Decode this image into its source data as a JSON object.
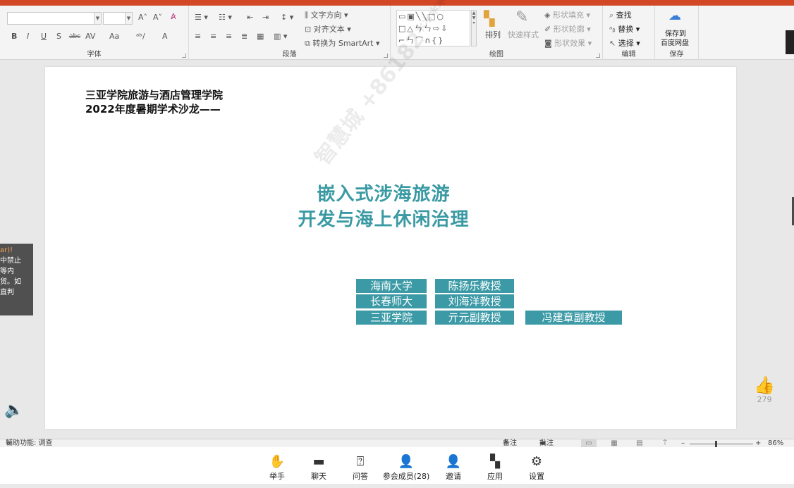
{
  "ribbon": {
    "groups": {
      "font": "字体",
      "paragraph": "段落",
      "drawing": "绘图",
      "editing": "编辑",
      "save": "保存"
    },
    "font_buttons": [
      "B",
      "I",
      "U",
      "S",
      "abc",
      "AV",
      "Aa",
      "A",
      "A"
    ],
    "text_direction": "文字方向",
    "align_text": "对齐文本",
    "convert_smartart": "转换为 SmartArt",
    "arrange": "排列",
    "quick_styles": "快速样式",
    "shape_fill": "形状填充",
    "shape_outline": "形状轮廓",
    "shape_effects": "形状效果",
    "find": "查找",
    "replace": "替换",
    "select": "选择",
    "save_to": "保存到",
    "baidu_pan": "百度网盘"
  },
  "slide": {
    "header_line1": "三亚学院旅游与酒店管理学院",
    "header_line2": "2022年度暑期学术沙龙——",
    "title_line1": "嵌入式涉海旅游",
    "title_line2": "开发与海上休闲治理",
    "tags": {
      "t1": "海南大学",
      "t2": "陈扬乐教授",
      "t3": "长春师大",
      "t4": "刘海洋教授",
      "t5": "三亚学院",
      "t6": "亓元副教授",
      "t7": "冯建章副教授"
    },
    "accent_color": "#3b9aa6"
  },
  "left_tip": {
    "line1": "ar)!",
    "line2": "中禁止",
    "line3": "等内",
    "line4": "货。如",
    "line5": "直判"
  },
  "likes": "279",
  "status": {
    "accessibility": "辅助功能: 调查",
    "notes": "备注",
    "comments": "批注",
    "zoom": "86%"
  },
  "toolbar": {
    "raise_hand": "举手",
    "chat": "聊天",
    "qa": "问答",
    "participants": "参会成员(28)",
    "invite": "邀请",
    "apps": "应用",
    "settings": "设置"
  }
}
